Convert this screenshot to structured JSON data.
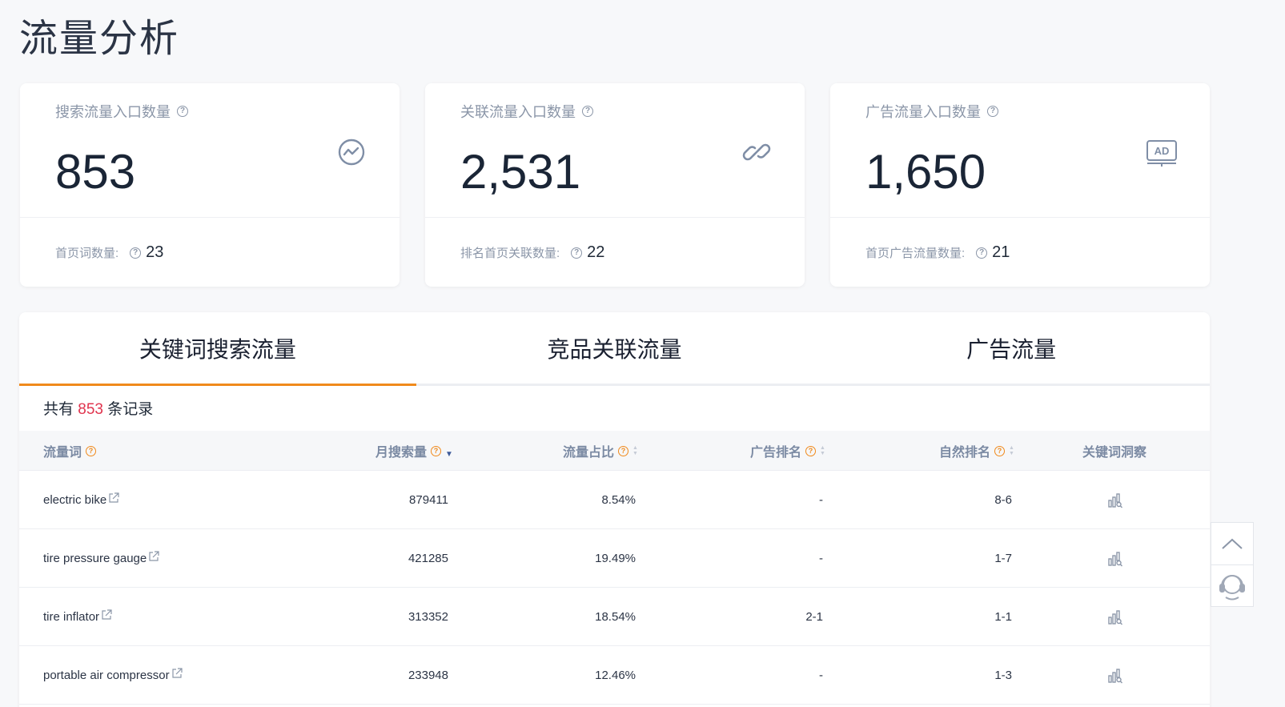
{
  "page": {
    "title": "流量分析"
  },
  "cards": [
    {
      "label": "搜索流量入口数量",
      "value": "853",
      "icon": "trend-circle-icon",
      "sub_label": "首页词数量:",
      "sub_value": "23"
    },
    {
      "label": "关联流量入口数量",
      "value": "2,531",
      "icon": "link-icon",
      "sub_label": "排名首页关联数量:",
      "sub_value": "22"
    },
    {
      "label": "广告流量入口数量",
      "value": "1,650",
      "icon": "ad-icon",
      "ad_text": "AD",
      "sub_label": "首页广告流量数量:",
      "sub_value": "21"
    }
  ],
  "tabs": [
    {
      "label": "关键词搜索流量",
      "active": true
    },
    {
      "label": "竞品关联流量",
      "active": false
    },
    {
      "label": "广告流量",
      "active": false
    }
  ],
  "records": {
    "prefix": "共有",
    "count": "853",
    "suffix": "条记录"
  },
  "table": {
    "headers": {
      "keyword": "流量词",
      "monthly_search": "月搜索量",
      "traffic_share": "流量占比",
      "ad_rank": "广告排名",
      "natural_rank": "自然排名",
      "insight": "关键词洞察"
    },
    "rows": [
      {
        "keyword": "electric bike",
        "monthly_search": "879411",
        "traffic_share": "8.54%",
        "ad_rank": "-",
        "natural_rank": "8-6"
      },
      {
        "keyword": "tire pressure gauge",
        "monthly_search": "421285",
        "traffic_share": "19.49%",
        "ad_rank": "-",
        "natural_rank": "1-7"
      },
      {
        "keyword": "tire inflator",
        "monthly_search": "313352",
        "traffic_share": "18.54%",
        "ad_rank": "2-1",
        "natural_rank": "1-1"
      },
      {
        "keyword": "portable air compressor",
        "monthly_search": "233948",
        "traffic_share": "12.46%",
        "ad_rank": "-",
        "natural_rank": "1-3"
      }
    ]
  },
  "colors": {
    "accent": "#f08a1c",
    "highlight": "#e0344e",
    "muted": "#8b96a8"
  },
  "float": {
    "top_icon": "chevron-up-icon",
    "bottom_icon": "customer-service-icon"
  }
}
